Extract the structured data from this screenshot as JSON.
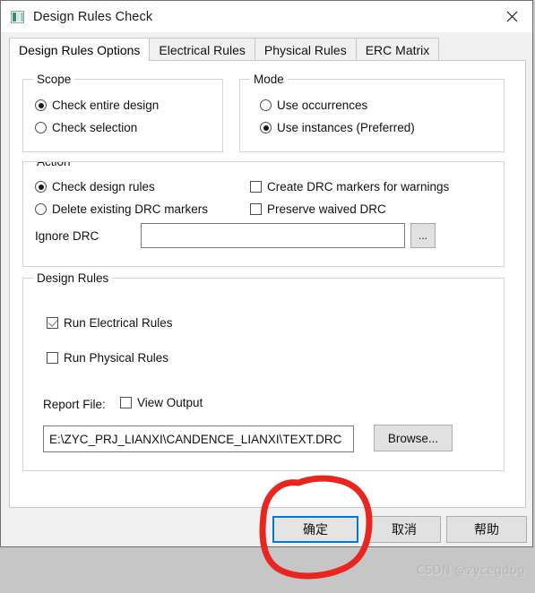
{
  "window": {
    "title": "Design Rules Check",
    "icon": "app-icon",
    "close_label": "✕"
  },
  "tabs": [
    {
      "label": "Design Rules Options",
      "active": true
    },
    {
      "label": "Electrical Rules",
      "active": false
    },
    {
      "label": "Physical Rules",
      "active": false
    },
    {
      "label": "ERC Matrix",
      "active": false
    }
  ],
  "scope": {
    "legend": "Scope",
    "options": [
      {
        "label": "Check entire design",
        "selected": true
      },
      {
        "label": "Check selection",
        "selected": false
      }
    ]
  },
  "mode": {
    "legend": "Mode",
    "options": [
      {
        "label": "Use occurrences",
        "selected": false
      },
      {
        "label": "Use instances (Preferred)",
        "selected": true
      }
    ]
  },
  "action": {
    "legend": "Action",
    "radios": [
      {
        "label": "Check design rules",
        "selected": true
      },
      {
        "label": "Delete existing DRC markers",
        "selected": false
      }
    ],
    "checkboxes": [
      {
        "label": "Create DRC markers for warnings",
        "checked": false
      },
      {
        "label": "Preserve waived DRC",
        "checked": false
      }
    ],
    "ignore_drc_label": "Ignore DRC",
    "ignore_drc_value": "",
    "ignore_drc_placeholder": "",
    "browse_ellipsis_label": "..."
  },
  "design_rules": {
    "legend": "Design Rules",
    "checkboxes": [
      {
        "label": "Run Electrical Rules",
        "checked": true
      },
      {
        "label": "Run Physical Rules",
        "checked": false
      }
    ],
    "report_file_label": "Report File:",
    "view_output_label": "View Output",
    "view_output_checked": false,
    "report_path": "E:\\ZYC_PRJ_LIANXI\\CANDENCE_LIANXI\\TEXT.DRC",
    "browse_label": "Browse..."
  },
  "footer": {
    "ok_label": "确定",
    "cancel_label": "取消",
    "help_label": "帮助"
  },
  "annotation": {
    "shape": "red-circle-highlight",
    "color": "#e8251f",
    "target": "ok-button"
  },
  "watermark": {
    "text": "CSDN @zycegdbg"
  },
  "colors": {
    "accent": "#0078d7",
    "dialog_bg": "#f0f0f0",
    "page_bg": "#ffffff",
    "backdrop": "#c6c6c6",
    "annotation_red": "#e8251f"
  }
}
